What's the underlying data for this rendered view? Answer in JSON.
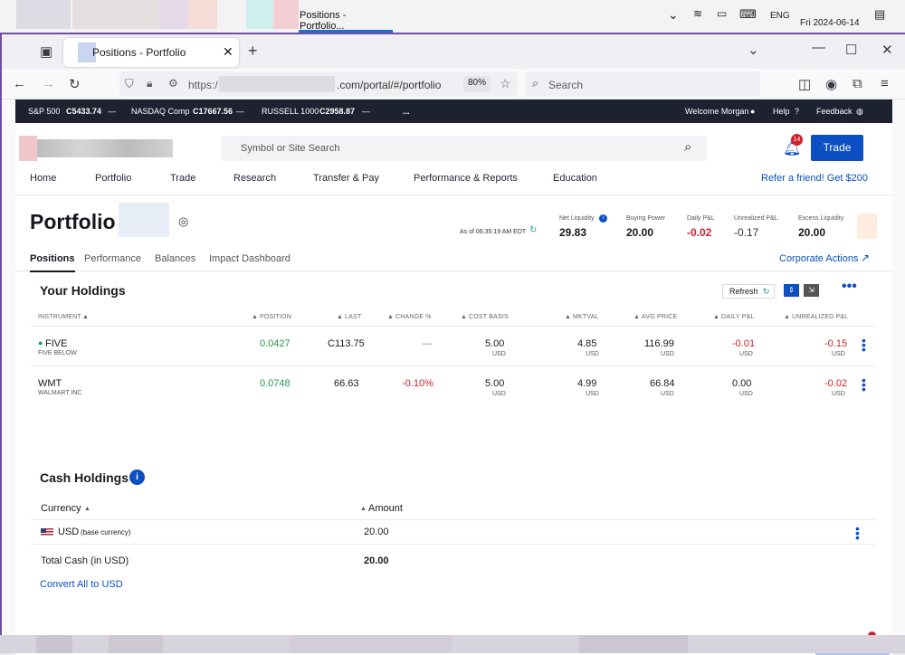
{
  "taskbar": {
    "active_window_title": "Positions - Portfolio...",
    "language": "ENG",
    "datetime": "Fri 2024-06-14",
    "notification_count": "1"
  },
  "browser": {
    "tab_title": "Positions - Portfolio",
    "url_prefix": "https:/",
    "url_suffix": ".com/portal/#/portfolio",
    "zoom": "80%",
    "search_placeholder": "Search"
  },
  "ticker": {
    "items": [
      {
        "label": "S&P 500",
        "value": "C5433.74"
      },
      {
        "label": "NASDAQ Comp",
        "value": "C17667.56"
      },
      {
        "label": "RUSSELL 1000",
        "value": "C2958.87"
      }
    ],
    "more": "...",
    "welcome": "Welcome Morgan",
    "help": "Help",
    "feedback": "Feedback"
  },
  "header": {
    "search_placeholder": "Symbol or Site Search",
    "notification_count": "14",
    "trade_label": "Trade"
  },
  "nav": {
    "items": [
      "Home",
      "Portfolio",
      "Trade",
      "Research",
      "Transfer & Pay",
      "Performance & Reports",
      "Education"
    ],
    "referral": "Refer a friend! Get $200"
  },
  "portfolio": {
    "title": "Portfolio",
    "as_of": "As of 06:35:19 AM EDT",
    "metrics": [
      {
        "label": "Net Liquidity",
        "value": "29.83"
      },
      {
        "label": "Buying Power",
        "value": "20.00"
      },
      {
        "label": "Daily P&L",
        "value": "-0.02"
      },
      {
        "label": "Unrealized P&L",
        "value": "-0.17"
      },
      {
        "label": "Excess Liquidity",
        "value": "20.00"
      }
    ],
    "tabs": [
      "Positions",
      "Performance",
      "Balances",
      "Impact Dashboard"
    ],
    "corporate_actions": "Corporate Actions"
  },
  "holdings": {
    "title": "Your Holdings",
    "refresh_label": "Refresh",
    "columns": [
      "INSTRUMENT",
      "POSITION",
      "LAST",
      "CHANGE %",
      "COST BASIS",
      "MKTVAL",
      "AVG PRICE",
      "DAILY P&L",
      "UNREALIZED P&L"
    ],
    "rows": [
      {
        "symbol": "FIVE",
        "name": "FIVE BELOW",
        "position": "0.0427",
        "last": "C113.75",
        "change": "—",
        "cost_basis": "5.00",
        "cost_unit": "USD",
        "mktval": "4.85",
        "mktval_unit": "USD",
        "avg_price": "116.99",
        "avg_unit": "USD",
        "daily_pl": "-0.01",
        "daily_unit": "USD",
        "unrealized_pl": "-0.15",
        "unrealized_unit": "USD"
      },
      {
        "symbol": "WMT",
        "name": "WALMART INC",
        "position": "0.0748",
        "last": "66.63",
        "change": "-0.10%",
        "cost_basis": "5.00",
        "cost_unit": "USD",
        "mktval": "4.99",
        "mktval_unit": "USD",
        "avg_price": "66.84",
        "avg_unit": "USD",
        "daily_pl": "0.00",
        "daily_unit": "USD",
        "unrealized_pl": "-0.02",
        "unrealized_unit": "USD"
      }
    ]
  },
  "cash": {
    "title": "Cash Holdings",
    "col_currency": "Currency",
    "col_amount": "Amount",
    "row_currency": "USD",
    "row_currency_note": "(base currency)",
    "row_amount": "20.00",
    "total_label": "Total Cash (in USD)",
    "total_amount": "20.00",
    "convert_label": "Convert All to USD"
  },
  "colors": {
    "accent": "#0b4fc2",
    "positive": "#1f9a4a",
    "negative": "#d0202b",
    "ticker_bg": "#1c2230"
  }
}
